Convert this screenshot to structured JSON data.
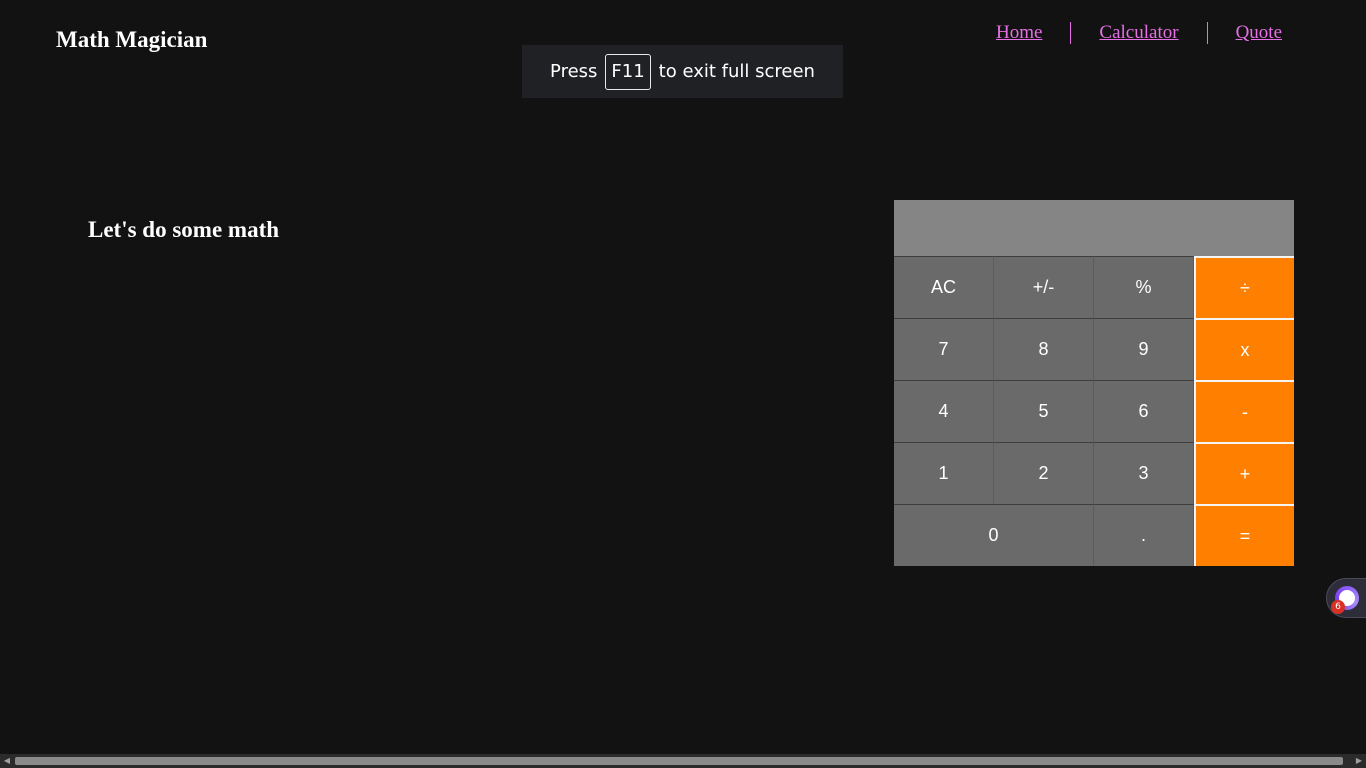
{
  "header": {
    "brand": "Math Magician",
    "nav": [
      {
        "label": "Home"
      },
      {
        "label": "Calculator"
      },
      {
        "label": "Quote"
      }
    ]
  },
  "fullscreen_notice": {
    "prefix": "Press",
    "key": "F11",
    "suffix": "to exit full screen"
  },
  "main": {
    "heading": "Let's do some math"
  },
  "calculator": {
    "display": "",
    "buttons": {
      "ac": "AC",
      "sign": "+/-",
      "percent": "%",
      "divide": "÷",
      "seven": "7",
      "eight": "8",
      "nine": "9",
      "multiply": "x",
      "four": "4",
      "five": "5",
      "six": "6",
      "minus": "-",
      "one": "1",
      "two": "2",
      "three": "3",
      "plus": "+",
      "zero": "0",
      "dot": ".",
      "equals": "="
    },
    "colors": {
      "operator": "#ff8000",
      "key": "#6a6a6a",
      "display": "#858585"
    }
  },
  "widget": {
    "badge": "6",
    "icon": "assistant-face-icon"
  },
  "colors": {
    "background": "#121212",
    "link": "#e56fe5"
  }
}
